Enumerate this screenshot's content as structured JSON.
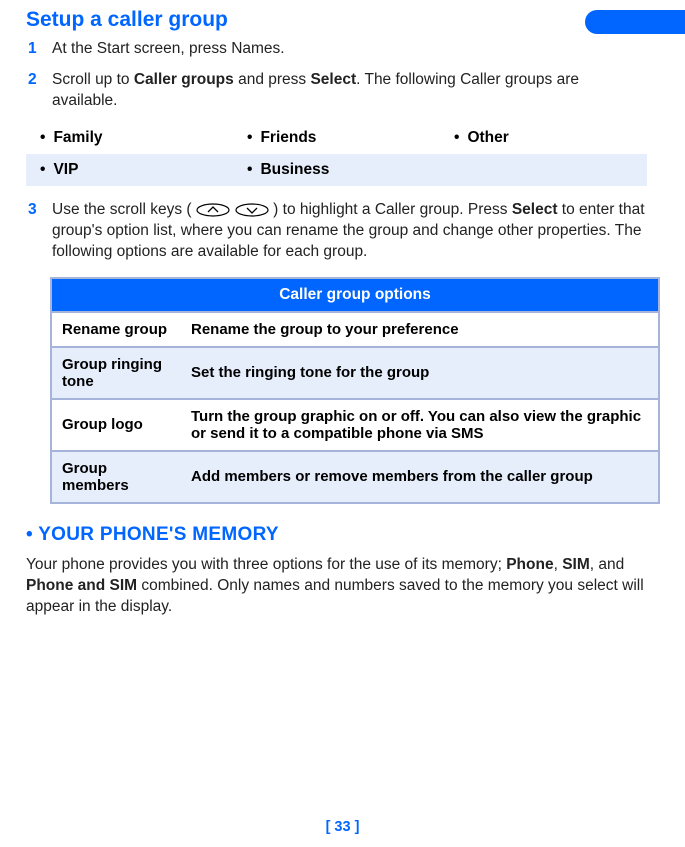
{
  "title": "Setup a caller group",
  "steps": {
    "s1": {
      "num": "1",
      "text_a": "At the Start screen, press Names."
    },
    "s2": {
      "num": "2",
      "text_a": "Scroll up to ",
      "b1": "Caller groups",
      "text_b": " and press ",
      "b2": "Select",
      "text_c": ". The following Caller groups are available."
    },
    "s3": {
      "num": "3",
      "text_a": "Use the scroll keys (",
      "text_b": ") to highlight a Caller group. Press ",
      "b1": "Select",
      "text_c": " to enter that group's option list, where you can rename the group and change other properties. The following options are available for each group."
    }
  },
  "groups": {
    "g1": "Family",
    "g2": "Friends",
    "g3": "Other",
    "g4": "VIP",
    "g5": "Business"
  },
  "table": {
    "header": "Caller group options",
    "r1": {
      "label": "Rename group",
      "desc": "Rename the group to your preference"
    },
    "r2": {
      "label": "Group ringing tone",
      "desc": "Set the ringing tone for the group"
    },
    "r3": {
      "label": "Group logo",
      "desc": "Turn the group graphic on or off. You can also view the graphic or send it to a compatible phone via SMS"
    },
    "r4": {
      "label": "Group members",
      "desc": "Add members or remove members from the caller group"
    }
  },
  "memory": {
    "heading": "YOUR PHONE'S MEMORY",
    "p_a": "Your phone provides you with three options for the use of its memory; ",
    "b1": "Phone",
    "sep1": ", ",
    "b2": "SIM",
    "sep2": ", and ",
    "b3": "Phone and SIM",
    "p_b": " combined. Only names and numbers saved to the memory you select will appear in the display."
  },
  "page_number": "[ 33 ]"
}
